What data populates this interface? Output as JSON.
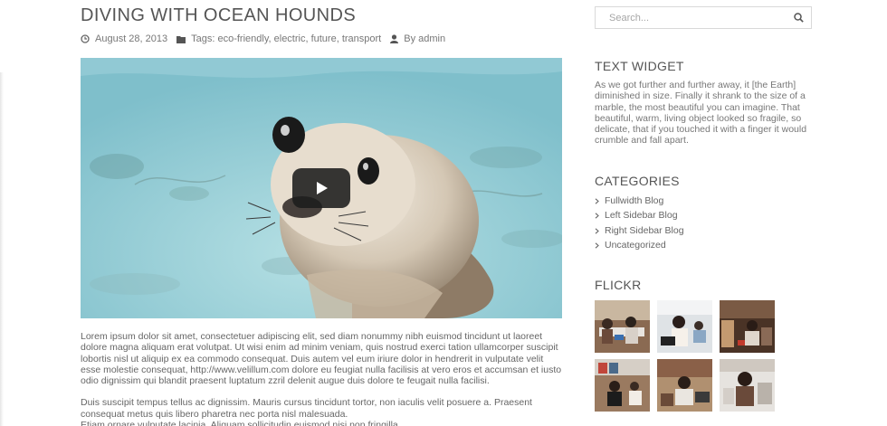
{
  "post": {
    "title": "DIVING WITH OCEAN HOUNDS",
    "date": "August 28, 2013",
    "tags": "Tags: eco-friendly, electric, future, transport",
    "author": "By admin",
    "paragraphs": [
      "Lorem ipsum dolor sit amet, consectetuer adipiscing elit, sed diam nonummy nibh euismod tincidunt ut laoreet dolore magna aliquam erat volutpat. Ut wisi enim ad minim veniam, quis nostrud exerci tation ullamcorper suscipit lobortis nisl ut aliquip ex ea commodo consequat. Duis autem vel eum iriure dolor in hendrerit in vulputate velit esse molestie consequat, http://www.velillum.com dolore eu feugiat nulla facilisis at vero eros et accumsan et iusto odio dignissim qui blandit praesent luptatum zzril delenit augue duis dolore te feugait nulla facilisi.",
      "Duis suscipit tempus tellus ac dignissim. Mauris cursus tincidunt tortor, non iaculis velit posuere a. Praesent consequat metus quis libero pharetra nec porta nisl malesuada.\nEtiam ornare vulputate lacinia. Aliquam sollicitudin euismod nisi non fringilla."
    ]
  },
  "sidebar": {
    "search": {
      "placeholder": "Search..."
    },
    "text_widget": {
      "title": "TEXT WIDGET",
      "body": "As we got further and further away, it [the Earth] diminished in size. Finally it shrank to the size of a marble, the most beautiful you can imagine. That beautiful, warm, living object looked so fragile, so delicate, that if you touched it with a finger it would crumble and fall apart."
    },
    "categories": {
      "title": "CATEGORIES",
      "items": [
        "Fullwidth Blog",
        "Left Sidebar Blog",
        "Right Sidebar Blog",
        "Uncategorized"
      ]
    },
    "flickr": {
      "title": "FLICKR"
    }
  },
  "icons": {
    "date": "clock-icon",
    "tags": "folder-icon",
    "author": "user-icon",
    "search": "search-icon",
    "play": "play-icon",
    "category": "chevron-right-icon"
  },
  "colors": {
    "heading": "#555555",
    "text": "#777777",
    "water": "#8ccbd6",
    "play_button": "#1c1c1c"
  }
}
